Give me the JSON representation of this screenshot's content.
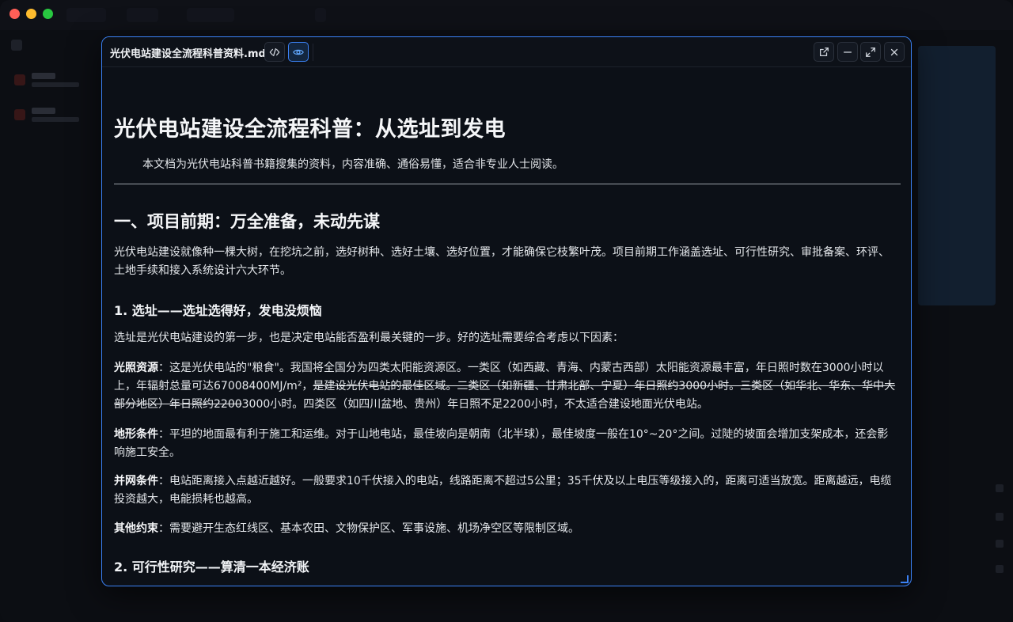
{
  "window": {
    "file_name": "光伏电站建设全流程科普资料.md",
    "accent": "#3b82f6",
    "view_mode": "preview"
  },
  "toolbar": {
    "icons": [
      "code-icon",
      "eye-icon",
      "external-link-icon",
      "minimize-icon",
      "maximize-icon",
      "close-icon"
    ]
  },
  "document": {
    "title": "光伏电站建设全流程科普：从选址到发电",
    "intro": "本文档为光伏电站科普书籍搜集的资料，内容准确、通俗易懂，适合非专业人士阅读。",
    "section1": {
      "heading": "一、项目前期：万全准备，未动先谋",
      "para": "光伏电站建设就像种一棵大树，在挖坑之前，选好树种、选好土壤、选好位置，才能确保它枝繁叶茂。项目前期工作涵盖选址、可行性研究、审批备案、环评、土地手续和接入系统设计六大环节。",
      "sub1": {
        "heading": "1. 选址——选址选得好，发电没烦恼",
        "para": "选址是光伏电站建设的第一步，也是决定电站能否盈利最关键的一步。好的选址需要综合考虑以下因素：",
        "light": {
          "label": "光照资源",
          "text_a": "：这是光伏电站的\"粮食\"。我国将全国分为四类太阳能资源区。一类区（如西藏、青海、内蒙古西部）太阳能资源最丰富，年日照时数在3000小时以上，年辐射总量可达67008400MJ/m²，",
          "text_strike": "是建设光伏电站的最佳区域。二类区（如新疆、甘肃北部、宁夏）年日照约3000小时。三类区（如华北、华东、华中大部分地区）年日照约2200",
          "text_b": "3000小时。四类区（如四川盆地、贵州）年日照不足2200小时，不太适合建设地面光伏电站。"
        },
        "terrain": {
          "label": "地形条件",
          "text": "：平坦的地面最有利于施工和运维。对于山地电站，最佳坡向是朝南（北半球），最佳坡度一般在10°~20°之间。过陡的坡面会增加支架成本，还会影响施工安全。"
        },
        "grid": {
          "label": "并网条件",
          "text": "：电站距离接入点越近越好。一般要求10千伏接入的电站，线路距离不超过5公里；35千伏及以上电压等级接入的，距离可适当放宽。距离越远，电缆投资越大，电能损耗也越高。"
        },
        "other": {
          "label": "其他约束",
          "text": "：需要避开生态红线区、基本农田、文物保护区、军事设施、机场净空区等限制区域。"
        }
      },
      "sub2": {
        "heading": "2. 可行性研究——算清一本经济账"
      }
    }
  }
}
